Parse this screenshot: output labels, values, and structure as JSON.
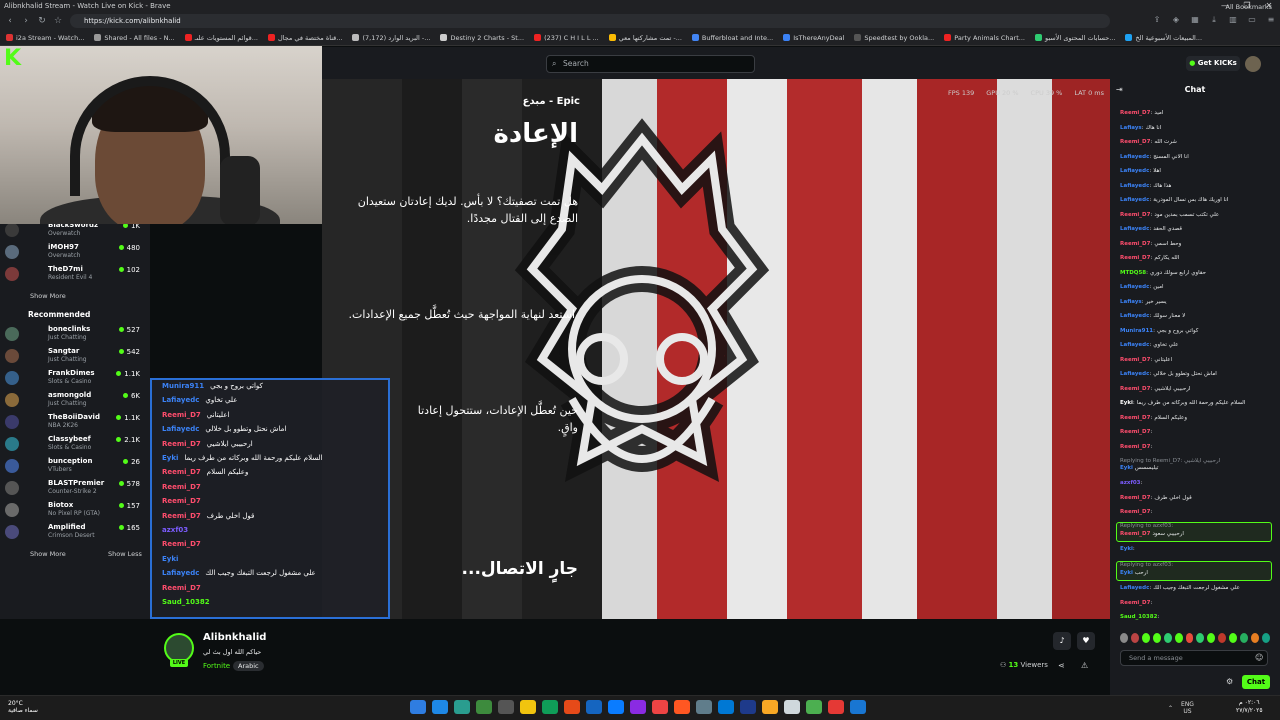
{
  "window": {
    "title": "Alibnkhalid Stream - Watch Live on Kick - Brave",
    "url": "https://kick.com/alibnkhalid",
    "controls": [
      "—",
      "❐",
      "✕"
    ]
  },
  "bookmarks": [
    {
      "label": "i2a Stream - Watch...",
      "color": "#d33"
    },
    {
      "label": "Shared - All files - N...",
      "color": "#999"
    },
    {
      "label": "قوائم المستويات علىـ...",
      "color": "#e22"
    },
    {
      "label": "قناة مختصة في مجال...",
      "color": "#e22"
    },
    {
      "label": "(7,172) البريد الوارد -...",
      "color": "#bbb"
    },
    {
      "label": "Destiny 2 Charts - St...",
      "color": "#ccc"
    },
    {
      "label": "(237) C H I L L ...",
      "color": "#e22"
    },
    {
      "label": "تمت مشاركتها معي -...",
      "color": "#fbbc04"
    },
    {
      "label": "Bufferbloat and Inte...",
      "color": "#4285f4"
    },
    {
      "label": "IsThereAnyDeal",
      "color": "#3b82f6"
    },
    {
      "label": "Speedtest by Ookla...",
      "color": "#555"
    },
    {
      "label": "Party Animals Chart...",
      "color": "#e22"
    },
    {
      "label": "حسابات المحتوى الأسبو...",
      "color": "#2ecc71"
    },
    {
      "label": "المبيعات الأسبوعية الخ...",
      "color": "#1da1f2"
    }
  ],
  "all_bookmarks": "All Bookmarks",
  "topnav": {
    "search_placeholder": "Search",
    "get_kicks": "Get KICKs"
  },
  "sidebar": {
    "following": [
      {
        "name": "BlackSwordz",
        "game": "Overwatch",
        "viewers": "1K"
      },
      {
        "name": "iMOH97",
        "game": "Overwatch",
        "viewers": "480"
      },
      {
        "name": "TheD7mi",
        "game": "Resident Evil 4",
        "viewers": "102"
      }
    ],
    "show_more_1": "Show More",
    "recommended_title": "Recommended",
    "recommended": [
      {
        "name": "boneclinks",
        "game": "Just Chatting",
        "viewers": "527"
      },
      {
        "name": "Sangtar",
        "game": "Just Chatting",
        "viewers": "542"
      },
      {
        "name": "FrankDimes",
        "game": "Slots & Casino",
        "viewers": "1.1K"
      },
      {
        "name": "asmongold",
        "game": "Just Chatting",
        "viewers": "6K"
      },
      {
        "name": "TheBoiiDavid",
        "game": "NBA 2K26",
        "viewers": "1.1K"
      },
      {
        "name": "Classybeef",
        "game": "Slots & Casino",
        "viewers": "2.1K"
      },
      {
        "name": "bunception",
        "game": "VTubers",
        "viewers": "26"
      },
      {
        "name": "BLASTPremier",
        "game": "Counter-Strike 2",
        "viewers": "578"
      },
      {
        "name": "Biotox",
        "game": "No Pixel RP (GTA)",
        "viewers": "157"
      },
      {
        "name": "Amplified",
        "game": "Crimson Desert",
        "viewers": "165"
      }
    ],
    "show_more_2": "Show More",
    "show_less": "Show Less"
  },
  "video": {
    "stats": [
      "FPS 139",
      "GPU 20 %",
      "CPU 39 %",
      "LAT 0 ms"
    ],
    "rarity": "Epic - مبدع",
    "heading": "الإعادة",
    "para1": "هل تمت تصفيتك؟ لا بأس. لديك إعادتان ستعيدان",
    "para1b": "الصدع إلى القتال مجددًا.",
    "para2": "استعد لنهاية المواجهة حيث تُعطَّل جميع الإعدادات.",
    "para3": "حين تُعطَّل الإعادات، ستتحول إعادتا",
    "para3b": "واقٍ.",
    "connecting": "جارٍ الاتصال..."
  },
  "overlay_chat": [
    {
      "user": "Munira911",
      "msg": "كواتي بروح و بجي",
      "color": "#3b82f6"
    },
    {
      "user": "Lafiayedc",
      "msg": "علي تخاوي",
      "color": "#3b82f6"
    },
    {
      "user": "Reemi_D7",
      "msg": "اعليتاني",
      "color": "#ff4d6d"
    },
    {
      "user": "Lafiayedc",
      "msg": "اماش نحتل وتطوو بل خلالي",
      "color": "#3b82f6"
    },
    {
      "user": "Reemi_D7",
      "msg": "ارحبيبي ايلاشيي",
      "color": "#ff4d6d"
    },
    {
      "user": "Eyki",
      "msg": "السلام عليكم ورحمة الله وبركاته من طرف ريما",
      "color": "#3b82f6"
    },
    {
      "user": "Reemi_D7",
      "msg": "وعليكم السلام",
      "color": "#ff4d6d"
    },
    {
      "user": "Reemi_D7",
      "msg": "",
      "color": "#ff4d6d"
    },
    {
      "user": "Reemi_D7",
      "msg": "",
      "color": "#ff4d6d"
    },
    {
      "user": "Reemi_D7",
      "msg": "قول اخلي طرف",
      "color": "#ff4d6d"
    },
    {
      "user": "azxf03",
      "msg": "",
      "color": "#7c5cff"
    },
    {
      "user": "Reemi_D7",
      "msg": "",
      "color": "#ff4d6d"
    },
    {
      "user": "Eyki",
      "msg": "",
      "color": "#3b82f6"
    },
    {
      "user": "Lafiayedc",
      "msg": "علي مشغول لرجعت التبغك وجيب الك",
      "color": "#3b82f6"
    },
    {
      "user": "Reemi_D7",
      "msg": "",
      "color": "#ff4d6d"
    },
    {
      "user": "Saud_10382",
      "msg": "",
      "color": "#53fc18"
    }
  ],
  "channel": {
    "name": "Alibnkhalid",
    "live_badge": "LIVE",
    "title": "حياكم الله اول بث لي",
    "category": "Fortnite",
    "language": "Arabic",
    "viewers_count": "13",
    "viewers_label": "Viewers"
  },
  "chat": {
    "title": "Chat",
    "input_placeholder": "Send a message",
    "send_label": "Chat",
    "messages": [
      {
        "user": "Reemi_D7",
        "msg": "اميد",
        "color": "#ff4d6d"
      },
      {
        "user": "Lafiays",
        "msg": "انا هاك",
        "color": "#3b82f6"
      },
      {
        "user": "Reemi_D7",
        "msg": "شرت الله",
        "color": "#ff4d6d"
      },
      {
        "user": "Lafiayedc",
        "msg": "انا الاني المسنج",
        "color": "#3b82f6"
      },
      {
        "user": "Lafiayedc",
        "msg": "اهلا",
        "color": "#3b82f6"
      },
      {
        "user": "Lafiayedc",
        "msg": "هذا هاك",
        "color": "#3b82f6"
      },
      {
        "user": "Lafiayedc",
        "msg": "انا اوريك هاك بس نسال المودرية",
        "color": "#3b82f6"
      },
      {
        "user": "Reemi_D7",
        "msg": "علي تكتب تسمب بمدين مود",
        "color": "#ff4d6d"
      },
      {
        "user": "Lafiayedc",
        "msg": "قصدي الحقد",
        "color": "#3b82f6"
      },
      {
        "user": "Reemi_D7",
        "msg": "وحط اسمي",
        "color": "#ff4d6d"
      },
      {
        "user": "Reemi_D7",
        "msg": "الله يكاركم",
        "color": "#ff4d6d"
      },
      {
        "user": "MTDQ58",
        "msg": "حقاوي ارابع سولك دوري",
        "color": "#53fc18"
      },
      {
        "user": "Lafiayedc",
        "msg": "امين",
        "color": "#3b82f6"
      },
      {
        "user": "Lafiays",
        "msg": "يسير خير",
        "color": "#3b82f6"
      },
      {
        "user": "Lafiayedc",
        "msg": "لا معنار سولك",
        "color": "#3b82f6"
      },
      {
        "user": "Munira911",
        "msg": "كواتي بروح و بجي",
        "color": "#3b82f6"
      },
      {
        "user": "Lafiayedc",
        "msg": "علي تخاوي",
        "color": "#3b82f6"
      },
      {
        "user": "Reemi_D7",
        "msg": "اعليتاني",
        "color": "#ff4d6d"
      },
      {
        "user": "Lafiayedc",
        "msg": "اماش نحتل وتطوو بل خلالي",
        "color": "#3b82f6"
      },
      {
        "user": "Reemi_D7",
        "msg": "ارحبيبي ايلاشيي",
        "color": "#ff4d6d"
      },
      {
        "user": "Eyki",
        "msg": "السلام عليكم ورحمة الله وبركاته من طرف ريما",
        "color": "#ffffff"
      },
      {
        "user": "Reemi_D7",
        "msg": "وعليكم السلام",
        "color": "#ff4d6d"
      },
      {
        "user": "Reemi_D7",
        "msg": "",
        "color": "#ff4d6d"
      },
      {
        "user": "Reemi_D7",
        "msg": "",
        "color": "#ff4d6d"
      }
    ],
    "reply1": "Replying to Reemi_D7: ارحبيبي ايلاشيي",
    "reply1_user": "Eyki",
    "reply1_msg": "تيليسسس",
    "after1": [
      {
        "user": "azxf03",
        "msg": "",
        "color": "#7c5cff"
      },
      {
        "user": "Reemi_D7",
        "msg": "قول اخلي طرف",
        "color": "#ff4d6d"
      },
      {
        "user": "Reemi_D7",
        "msg": "",
        "color": "#ff4d6d"
      }
    ],
    "reply2": "Replying to azxf03:",
    "reply2_user": "Reemi_D7",
    "reply2_msg": "ارحبيبي سعود",
    "after2": [
      {
        "user": "Eyki",
        "msg": "",
        "color": "#3b82f6"
      }
    ],
    "reply3": "Replying to azxf03:",
    "reply3_user": "Eyki",
    "reply3_msg": "ارحب",
    "after3": [
      {
        "user": "Lafiayedc",
        "msg": "علي مشغول لرجعت التبغك وجيب الك",
        "color": "#3b82f6"
      },
      {
        "user": "Reemi_D7",
        "msg": "",
        "color": "#ff4d6d"
      },
      {
        "user": "Saud_10382",
        "msg": "",
        "color": "#53fc18"
      }
    ]
  },
  "taskbar": {
    "temp": "20°C",
    "weather": "سماء صافية",
    "lang": "ENG",
    "region": "US",
    "time": "٠٢:٠٦ م",
    "date": "٢٧/٧/٢٠٢٥"
  }
}
